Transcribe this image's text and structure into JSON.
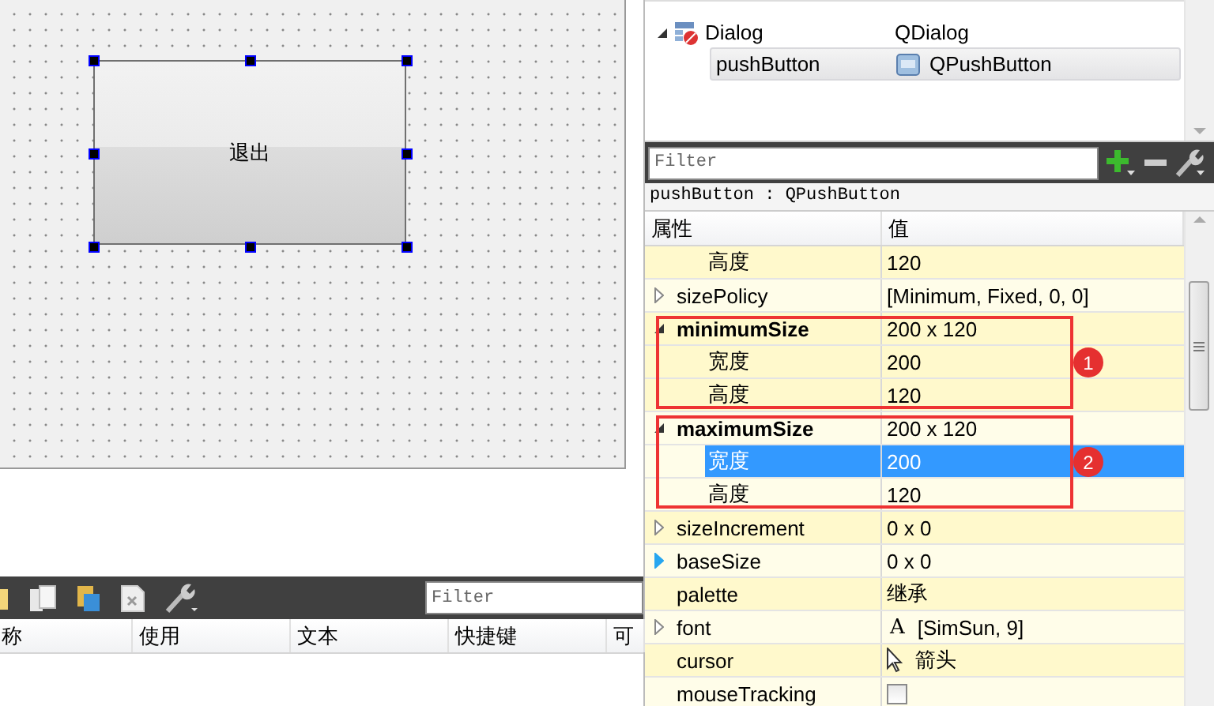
{
  "designer": {
    "button": {
      "text": "退出",
      "selected": true
    }
  },
  "action_editor": {
    "filter": {
      "placeholder": "Filter"
    },
    "columns": [
      "称",
      "使用",
      "文本",
      "快捷键",
      "可"
    ]
  },
  "object_inspector": {
    "rows": [
      {
        "name": "Dialog",
        "class": "QDialog",
        "expanded": true,
        "selected": false,
        "children": [
          {
            "name": "pushButton",
            "class": "QPushButton",
            "selected": true
          }
        ]
      }
    ]
  },
  "property_editor": {
    "filter": {
      "placeholder": "Filter"
    },
    "object_label": "pushButton : QPushButton",
    "columns": [
      "属性",
      "值"
    ],
    "properties": [
      {
        "kind": "group",
        "children": [
          {
            "name": "高度",
            "value": "120",
            "selected": false
          }
        ]
      },
      {
        "kind": "text",
        "name": "sizePolicy",
        "value": "[Minimum, Fixed, 0, 0]",
        "expanded": false,
        "modified": false,
        "hovered": false,
        "selected": false
      },
      {
        "kind": "text",
        "name": "minimumSize",
        "value": "200 x 120",
        "expanded": true,
        "modified": true,
        "hovered": false,
        "selected": false,
        "callout": "1",
        "children": [
          {
            "name": "宽度",
            "value": "200",
            "selected": false
          },
          {
            "name": "高度",
            "value": "120",
            "selected": false
          }
        ]
      },
      {
        "kind": "text",
        "name": "maximumSize",
        "value": "200 x 120",
        "expanded": true,
        "modified": true,
        "hovered": false,
        "selected": false,
        "callout": "2",
        "children": [
          {
            "name": "宽度",
            "value": "200",
            "selected": true
          },
          {
            "name": "高度",
            "value": "120",
            "selected": false
          }
        ]
      },
      {
        "kind": "text",
        "name": "sizeIncrement",
        "value": "0 x 0",
        "expanded": false,
        "modified": false,
        "hovered": false,
        "selected": false
      },
      {
        "kind": "text",
        "name": "baseSize",
        "value": "0 x 0",
        "expanded": false,
        "modified": false,
        "hovered": true,
        "selected": false
      },
      {
        "kind": "text",
        "name": "palette",
        "value": "继承",
        "modified": false,
        "selected": false
      },
      {
        "kind": "font",
        "name": "font",
        "glyph": "A",
        "value": "[SimSun, 9]",
        "expanded": false,
        "modified": false,
        "hovered": false,
        "selected": false
      },
      {
        "kind": "cursor",
        "name": "cursor",
        "value": "箭头",
        "modified": false,
        "selected": false
      },
      {
        "kind": "checkbox",
        "name": "mouseTracking",
        "checked": false,
        "modified": false,
        "selected": false
      }
    ]
  }
}
